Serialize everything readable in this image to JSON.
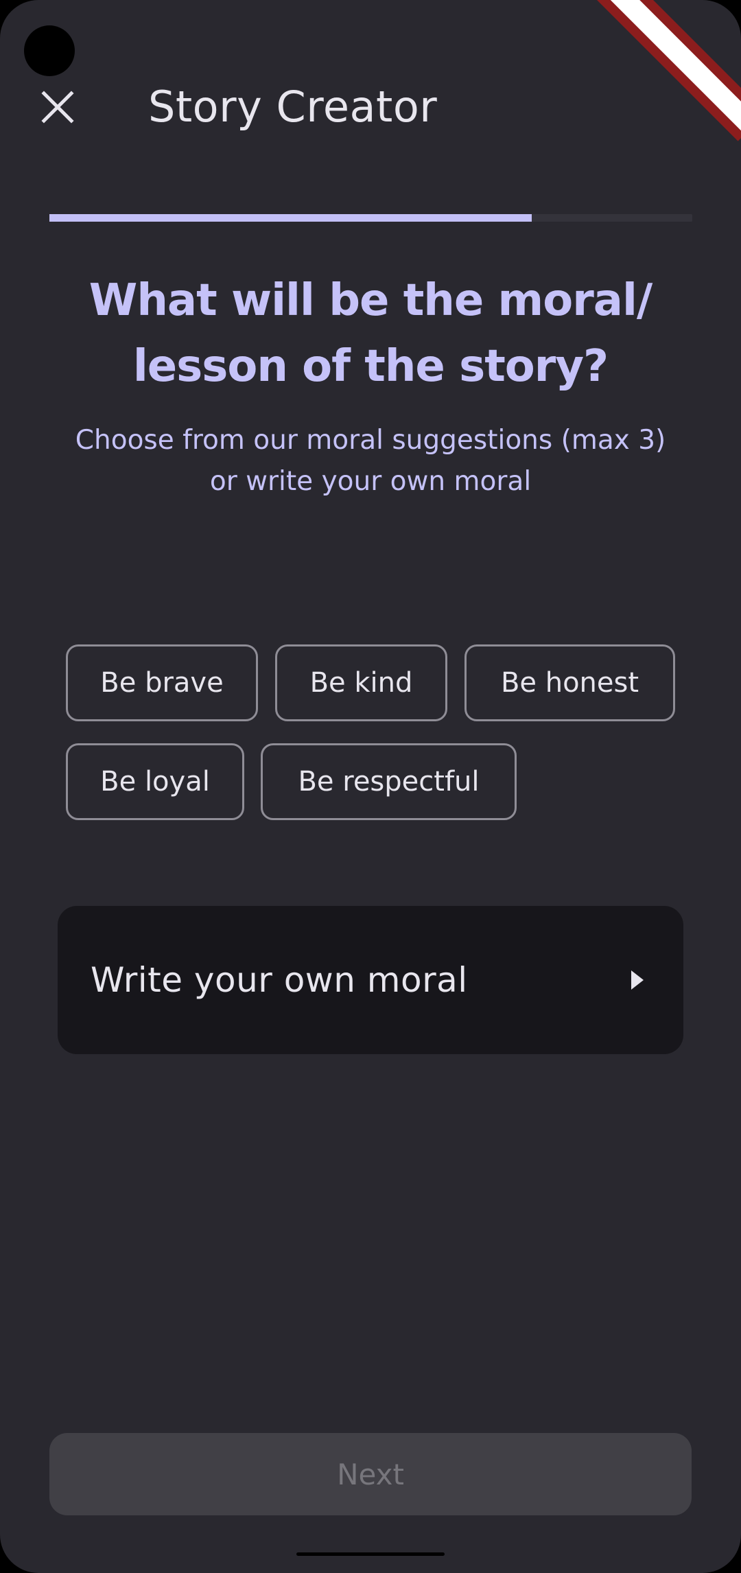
{
  "app_bar": {
    "title": "Story Creator",
    "close_icon": "close-icon"
  },
  "progress": {
    "value": 0.75
  },
  "question": {
    "line1": "What will be the moral/",
    "line2": "lesson of the story?"
  },
  "subtitle": {
    "line1": "Choose from our moral suggestions (max 3)",
    "line2": "or write your own moral"
  },
  "suggestions": [
    {
      "label": "Be brave"
    },
    {
      "label": "Be kind"
    },
    {
      "label": "Be honest"
    },
    {
      "label": "Be loyal"
    },
    {
      "label": "Be respectful"
    }
  ],
  "own_moral": {
    "label": "Write your own moral",
    "icon": "arrow-right-icon"
  },
  "footer": {
    "next_label": "Next"
  },
  "colors": {
    "accent": "#c3c0f7",
    "background": "#29282f",
    "card": "#17161b",
    "disabled_button": "#414046"
  }
}
